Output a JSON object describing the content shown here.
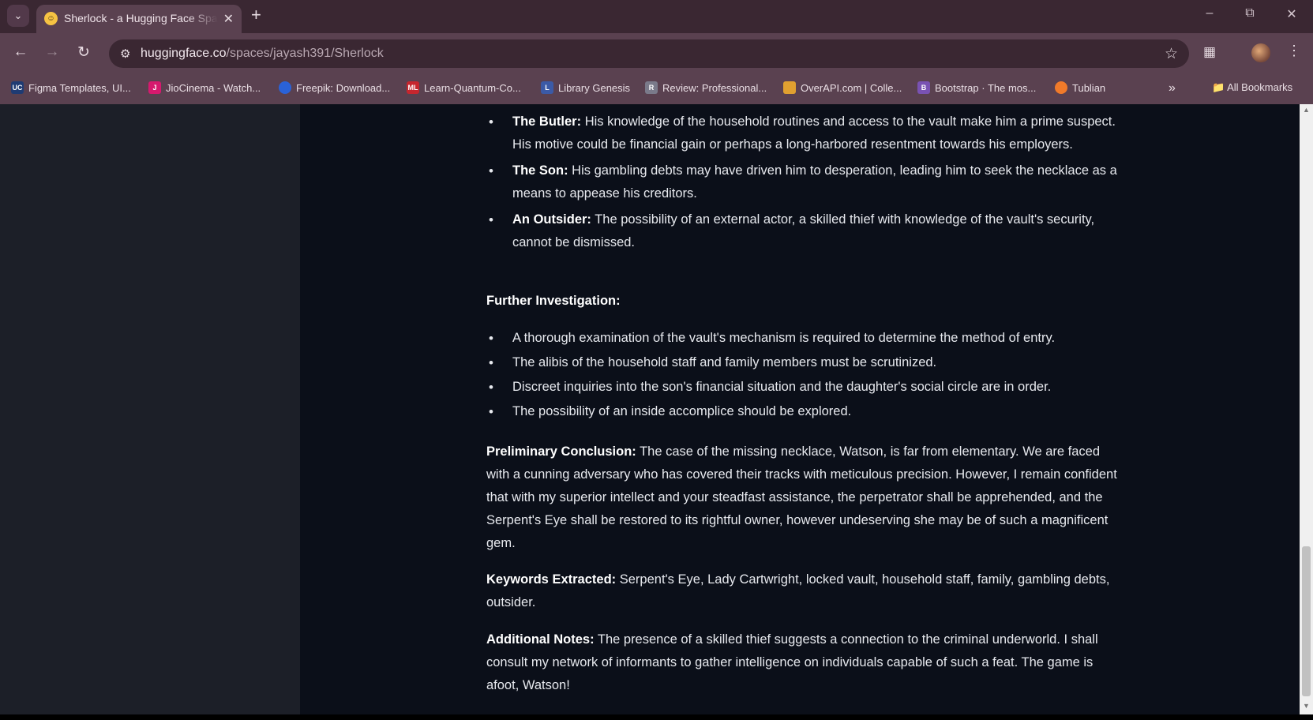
{
  "browser": {
    "tab_title": "Sherlock - a Hugging Face Space",
    "url_domain": "huggingface.co",
    "url_path": "/spaces/jayash391/Sherlock",
    "bookmarks": [
      {
        "label": "Figma Templates, UI...",
        "icon_text": "UC",
        "icon_color": "#1f3b73",
        "icon": "figma-templates-icon"
      },
      {
        "label": "JioCinema - Watch...",
        "icon_text": "J",
        "icon_color": "#d6196e",
        "icon": "jiocinema-icon"
      },
      {
        "label": "Freepik: Download...",
        "icon_text": "",
        "icon_color": "#2a62d8",
        "icon": "freepik-icon"
      },
      {
        "label": "Learn-Quantum-Co...",
        "icon_text": "ML",
        "icon_color": "#c6262e",
        "icon": "ml-icon"
      },
      {
        "label": "Library Genesis",
        "icon_text": "L",
        "icon_color": "#3b5aa6",
        "icon": "library-genesis-icon"
      },
      {
        "label": "Review: Professional...",
        "icon_text": "R",
        "icon_color": "#7a7a8a",
        "icon": "review-icon"
      },
      {
        "label": "OverAPI.com | Colle...",
        "icon_text": "",
        "icon_color": "#e0a030",
        "icon": "overapi-icon"
      },
      {
        "label": "Bootstrap · The mos...",
        "icon_text": "B",
        "icon_color": "#7952b3",
        "icon": "bootstrap-icon"
      },
      {
        "label": "Tublian",
        "icon_text": "",
        "icon_color": "#f07a2a",
        "icon": "tublian-icon"
      }
    ],
    "all_bookmarks_label": "All Bookmarks"
  },
  "content": {
    "suspects": [
      {
        "name": "The Butler:",
        "text": "His knowledge of the household routines and access to the vault make him a prime suspect. His motive could be financial gain or perhaps a long-harbored resentment towards his employers."
      },
      {
        "name": "The Son:",
        "text": "His gambling debts may have driven him to desperation, leading him to seek the necklace as a means to appease his creditors."
      },
      {
        "name": "An Outsider:",
        "text": "The possibility of an external actor, a skilled thief with knowledge of the vault's security, cannot be dismissed."
      }
    ],
    "further_heading": "Further Investigation:",
    "further_items": [
      "A thorough examination of the vault's mechanism is required to determine the method of entry.",
      "The alibis of the household staff and family members must be scrutinized.",
      "Discreet inquiries into the son's financial situation and the daughter's social circle are in order.",
      "The possibility of an inside accomplice should be explored."
    ],
    "conclusion_label": "Preliminary Conclusion:",
    "conclusion_text": "The case of the missing necklace, Watson, is far from elementary. We are faced with a cunning adversary who has covered their tracks with meticulous precision. However, I remain confident that with my superior intellect and your steadfast assistance, the perpetrator shall be apprehended, and the Serpent's Eye shall be restored to its rightful owner, however undeserving she may be of such a magnificent gem.",
    "keywords_label": "Keywords Extracted:",
    "keywords_text": "Serpent's Eye, Lady Cartwright, locked vault, household staff, family, gambling debts, outsider.",
    "notes_label": "Additional Notes:",
    "notes_text": "The presence of a skilled thief suggests a connection to the criminal underworld. I shall consult my network of informants to gather intelligence on individuals capable of such a feat. The game is afoot, Watson!"
  }
}
